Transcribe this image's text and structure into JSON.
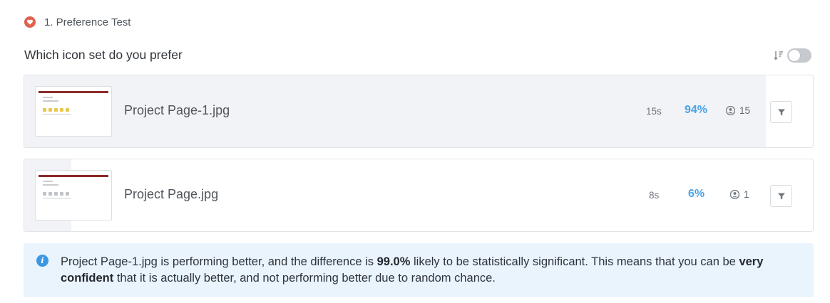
{
  "test": {
    "icon": "heart-icon",
    "title": "1. Preference Test"
  },
  "question": {
    "title": "Which icon set do you prefer"
  },
  "sort": {
    "icon": "sort-descending-icon",
    "toggle_on": false
  },
  "results": [
    {
      "file_name": "Project Page-1.jpg",
      "time": "15s",
      "percent": "94%",
      "preference_share": 0.94,
      "voters": "15",
      "filter_icon": "filter-icon"
    },
    {
      "file_name": "Project Page.jpg",
      "time": "8s",
      "percent": "6%",
      "preference_share": 0.06,
      "voters": "1",
      "filter_icon": "filter-icon"
    }
  ],
  "callout": {
    "icon": "info-icon",
    "text_1": "Project Page-1.jpg is performing better, and the difference is ",
    "bold_1": "99.0%",
    "text_2": " likely to be statistically significant. This means that you can be ",
    "bold_2": "very confident",
    "text_3": " that it is actually better, and not performing better due to random chance."
  },
  "colors": {
    "accent_blue": "#4aa3e8",
    "heart_red": "#e0624f",
    "callout_bg": "#eaf4fd",
    "bar_fill": "#f2f3f6"
  }
}
